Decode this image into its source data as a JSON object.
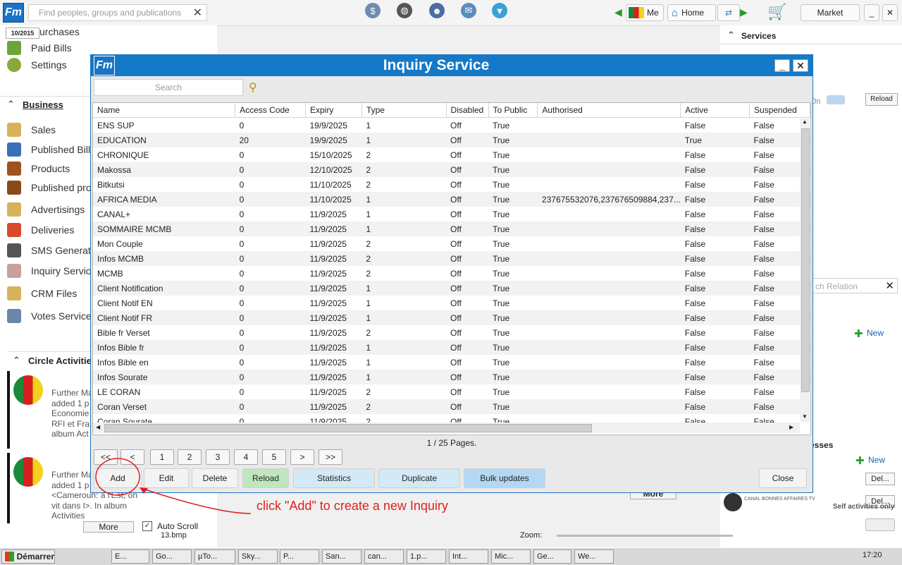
{
  "topbar": {
    "logo": "Fm",
    "search_placeholder": "Find peoples, groups and publications",
    "me_label": "Me",
    "home_label": "Home",
    "market_label": "Market"
  },
  "left": {
    "date_badge": "10/2015",
    "top_items": [
      "urchases",
      "Paid Bills",
      "Settings"
    ],
    "business_header": "Business",
    "business_items": [
      "Sales",
      "Published Bills",
      "Products",
      "Published pro",
      "Advertisings",
      "Deliveries",
      "SMS Generato",
      "Inquiry Servic",
      "CRM Files",
      "Votes Service"
    ],
    "circle_header": "Circle Activities",
    "activity1": [
      "Further Ma",
      "added 1 p",
      "Economie",
      "RFI et Fra",
      "album Act"
    ],
    "activity2": [
      "Further Ma",
      "added 1 p",
      "<Cameroun: a l'Est, on",
      "vit dans l>. In album",
      "Activities"
    ],
    "more_label": "More",
    "autoscroll_label": "Auto Scroll"
  },
  "right": {
    "services_header": "Services",
    "on_label": "On",
    "reload_label": "Reload",
    "search_relation": "ch Relation",
    "new_label1": "New",
    "addresses_header": "esses",
    "new_label2": "New",
    "del_label1": "Del...",
    "del_label2": "Del...",
    "canal_text": "CANAL BONNES AFFAIRES TV",
    "self_activities": "Self activities only"
  },
  "background": {
    "more_label": "More",
    "zoom_label": "Zoom:",
    "files_label": "13.bmp"
  },
  "dialog": {
    "logo": "Fm",
    "title": "Inquiry Service",
    "search_placeholder": "Search",
    "columns": [
      "Name",
      "Access Code",
      "Expiry",
      "Type",
      "Disabled",
      "To Public",
      "Authorised",
      "Active",
      "Suspended"
    ],
    "rows": [
      [
        "ENS SUP",
        "0",
        "19/9/2025",
        "1",
        "Off",
        "True",
        "",
        "False",
        "False"
      ],
      [
        "EDUCATION",
        "20",
        "19/9/2025",
        "1",
        "Off",
        "True",
        "",
        "True",
        "False"
      ],
      [
        "CHRONIQUE",
        "0",
        "15/10/2025",
        "2",
        "Off",
        "True",
        "",
        "False",
        "False"
      ],
      [
        "Makossa",
        "0",
        "12/10/2025",
        "2",
        "Off",
        "True",
        "",
        "False",
        "False"
      ],
      [
        "Bitkutsi",
        "0",
        "11/10/2025",
        "2",
        "Off",
        "True",
        "",
        "False",
        "False"
      ],
      [
        "AFRICA MEDIA",
        "0",
        "11/10/2025",
        "1",
        "Off",
        "True",
        "237675532076,237676509884,237...",
        "False",
        "False"
      ],
      [
        "CANAL+",
        "0",
        "11/9/2025",
        "1",
        "Off",
        "True",
        "",
        "False",
        "False"
      ],
      [
        "SOMMAIRE MCMB",
        "0",
        "11/9/2025",
        "1",
        "Off",
        "True",
        "",
        "False",
        "False"
      ],
      [
        "Mon Couple",
        "0",
        "11/9/2025",
        "2",
        "Off",
        "True",
        "",
        "False",
        "False"
      ],
      [
        "Infos MCMB",
        "0",
        "11/9/2025",
        "2",
        "Off",
        "True",
        "",
        "False",
        "False"
      ],
      [
        "MCMB",
        "0",
        "11/9/2025",
        "2",
        "Off",
        "True",
        "",
        "False",
        "False"
      ],
      [
        "Client Notification",
        "0",
        "11/9/2025",
        "1",
        "Off",
        "True",
        "",
        "False",
        "False"
      ],
      [
        "Client Notif EN",
        "0",
        "11/9/2025",
        "1",
        "Off",
        "True",
        "",
        "False",
        "False"
      ],
      [
        "Client Notif FR",
        "0",
        "11/9/2025",
        "1",
        "Off",
        "True",
        "",
        "False",
        "False"
      ],
      [
        "Bible fr Verset",
        "0",
        "11/9/2025",
        "2",
        "Off",
        "True",
        "",
        "False",
        "False"
      ],
      [
        "Infos Bible fr",
        "0",
        "11/9/2025",
        "1",
        "Off",
        "True",
        "",
        "False",
        "False"
      ],
      [
        "Infos Bible en",
        "0",
        "11/9/2025",
        "1",
        "Off",
        "True",
        "",
        "False",
        "False"
      ],
      [
        "Infos Sourate",
        "0",
        "11/9/2025",
        "1",
        "Off",
        "True",
        "",
        "False",
        "False"
      ],
      [
        "LE CORAN",
        "0",
        "11/9/2025",
        "2",
        "Off",
        "True",
        "",
        "False",
        "False"
      ],
      [
        "Coran Verset",
        "0",
        "11/9/2025",
        "2",
        "Off",
        "True",
        "",
        "False",
        "False"
      ],
      [
        "Coran Sourate",
        "0",
        "11/9/2025",
        "2",
        "Off",
        "True",
        "",
        "False",
        "False"
      ]
    ],
    "pages_label": "1 / 25 Pages.",
    "pager": [
      "<<",
      "<",
      "1",
      "2",
      "3",
      "4",
      "5",
      ">",
      ">>"
    ],
    "actions": [
      "Add",
      "Edit",
      "Delete",
      "Reload",
      "Statistics",
      "Duplicate",
      "Bulk updates"
    ],
    "close_label": "Close"
  },
  "annotation": {
    "text": "click \"Add\" to create a new Inquiry",
    "color": "#e02020"
  },
  "taskbar": {
    "start_label": "Démarrer",
    "tasks": [
      "E...",
      "Go...",
      "µTo...",
      "Sky...",
      "P...",
      "San...",
      "can...",
      "1.p...",
      "Int...",
      "Mic...",
      "Ge...",
      "We..."
    ],
    "clock": "17:20"
  },
  "colors": {
    "dialog_title_bg": "#1479c6",
    "reload_bg": "#bfe6bf",
    "statistics_bg": "#d3e9f6",
    "bulk_bg": "#b4d8f4"
  }
}
